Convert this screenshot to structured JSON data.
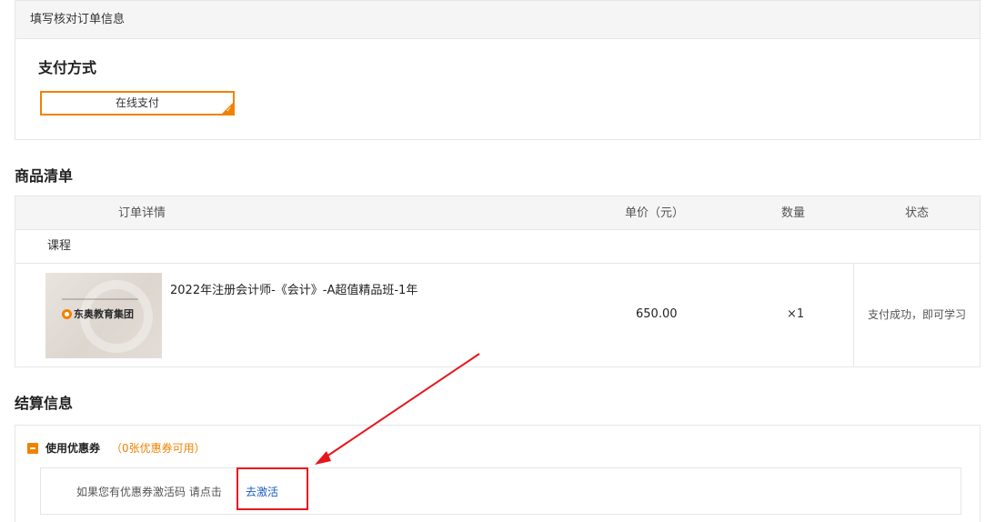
{
  "header": {
    "title": "填写核对订单信息"
  },
  "payment": {
    "title": "支付方式",
    "option": "在线支付",
    "check_glyph": "✓",
    "accent_color": "#f08200"
  },
  "goods": {
    "title": "商品清单",
    "columns": [
      "订单详情",
      "单价（元）",
      "数量",
      "状态"
    ],
    "group_label": "课程",
    "items": [
      {
        "thumbnail_logo_text": "东奥教育集团",
        "name": "2022年注册会计师-《会计》-A超值精品班-1年",
        "price": "650.00",
        "quantity": "×1",
        "status": "支付成功，即可学习"
      }
    ]
  },
  "settlement": {
    "title": "结算信息",
    "coupon_label": "使用优惠券",
    "coupon_count": "（0张优惠券可用）",
    "hint": "如果您有优惠券激活码 请点击",
    "activate_link": "去激活",
    "link_color": "#1a5dc8"
  },
  "annotation": {
    "highlight_color": "#e8141c"
  }
}
